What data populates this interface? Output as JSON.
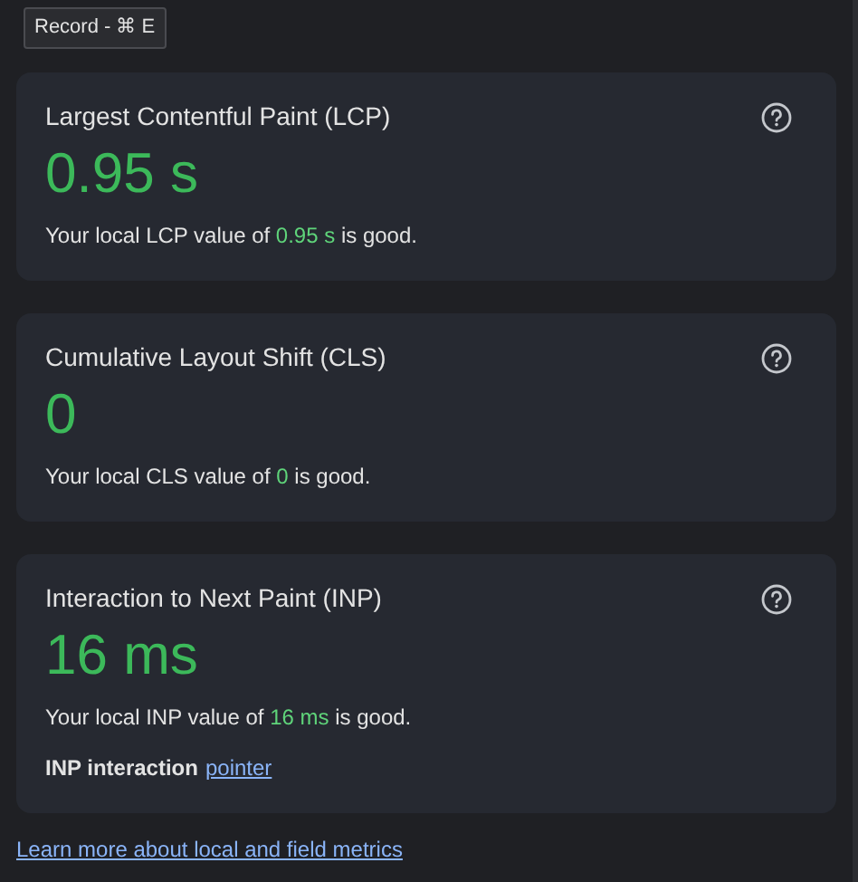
{
  "tooltip": "Record - ⌘ E",
  "metrics": [
    {
      "title": "Largest Contentful Paint (LCP)",
      "value": "0.95 s",
      "description": "Your local LCP value of **0.95 s** is good."
    },
    {
      "title": "Cumulative Layout Shift (CLS)",
      "value": "0",
      "description": "Your local CLS value of **0** is good."
    },
    {
      "title": "Interaction to Next Paint (INP)",
      "value": "16 ms",
      "description": "Your local INP value of **16 ms** is good.",
      "interaction": {
        "label": "INP interaction",
        "link": "pointer"
      }
    }
  ],
  "learn_more_link": "Learn more about local and field metrics"
}
